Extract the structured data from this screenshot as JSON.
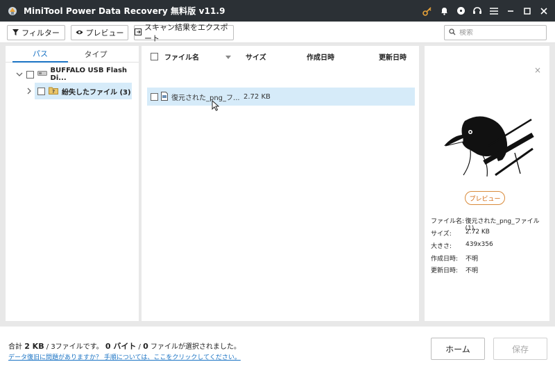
{
  "window": {
    "title": "MiniTool Power Data Recovery 無料版 v11.9",
    "icons": [
      "key-icon",
      "bell-icon",
      "disc-icon",
      "headset-icon",
      "menu-icon",
      "minimize-icon",
      "maximize-icon",
      "close-icon"
    ]
  },
  "toolbar": {
    "filter_label": "フィルター",
    "preview_label": "プレビュー",
    "export_label": "スキャン結果をエクスポート",
    "search_placeholder": "検索"
  },
  "left_panel": {
    "tabs": [
      {
        "label": "パス",
        "active": true
      },
      {
        "label": "タイプ",
        "active": false
      }
    ],
    "tree": [
      {
        "label": "BUFFALO USB Flash Di...",
        "expanded": true,
        "level": 0,
        "icon": "usb-drive-icon"
      },
      {
        "label": "紛失したファイル (3)",
        "expanded": false,
        "level": 1,
        "icon": "lost-folder-icon",
        "selected": true
      }
    ]
  },
  "file_list": {
    "columns": [
      "ファイル名",
      "サイズ",
      "作成日時",
      "更新日時"
    ],
    "rows": [
      {
        "name": "復元された_png_フ...",
        "size": "2.72 KB",
        "created": "",
        "modified": "",
        "icon": "png-file-icon"
      }
    ]
  },
  "preview": {
    "button_label": "プレビュー",
    "info": [
      {
        "key": "ファイル名:",
        "value": "復元された_png_ファイル(1)."
      },
      {
        "key": "サイズ:",
        "value": "2.72 KB"
      },
      {
        "key": "大きさ:",
        "value": "439x356"
      },
      {
        "key": "作成日時:",
        "value": "不明"
      },
      {
        "key": "更新日時:",
        "value": "不明"
      }
    ]
  },
  "footer": {
    "summary_prefix": "合計 ",
    "total_size": "2 KB",
    "summary_mid1": " / 3ファイルです。 ",
    "selected_size": "0 バイト",
    "summary_mid2": " / ",
    "selected_count": "0",
    "summary_suffix": " ファイルが選択されました。",
    "help_link": "データ復旧に問題がありますか？ 手順については、ここをクリックしてください。",
    "home_label": "ホーム",
    "save_label": "保存"
  },
  "colors": {
    "titlebar": "#2b3035",
    "accent": "#1a73c4",
    "selection": "#d6ebf9",
    "preview_button": "#d36a12"
  }
}
